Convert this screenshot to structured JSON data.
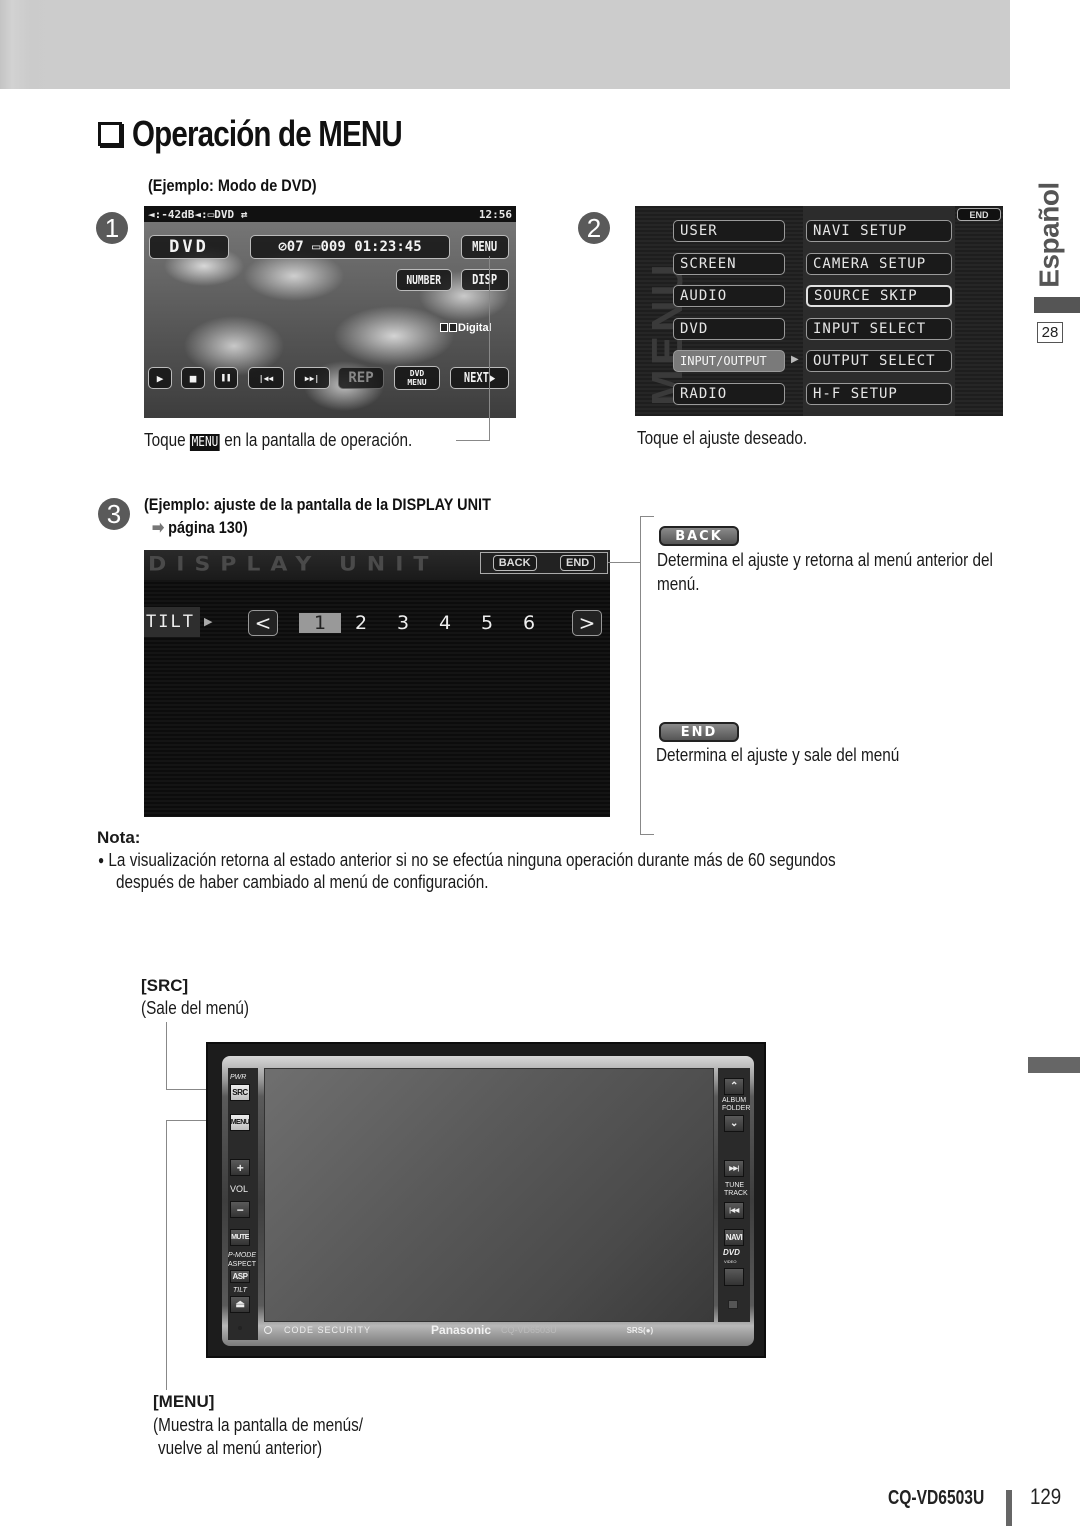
{
  "header": {
    "title": "Operación de MENU",
    "title_icon": "checkbox-square-icon"
  },
  "sidebar": {
    "language": "Español",
    "page_badge": "28"
  },
  "step1": {
    "number": "1",
    "caption": "(Ejemplo: Modo de DVD)",
    "instruction_pre": "Toque",
    "instruction_button": "MENU",
    "instruction_post": "en la pantalla de operación.",
    "screen": {
      "status_left": "◄:-42dB◄:▭DVD ⇄",
      "clock": "12:56",
      "source_label": "DVD",
      "track_info": "⊘07 ▭009 01:23:45",
      "buttons": {
        "menu": "MENU",
        "number": "NUMBER",
        "disp": "DISP",
        "rep": "REP",
        "dvd_menu_line1": "DVD",
        "dvd_menu_line2": "MENU",
        "next": "NEXT▶"
      },
      "transport": {
        "play": "▶",
        "stop": "■",
        "pause": "❚❚",
        "prev": "|◀◀",
        "next": "▶▶|"
      },
      "digital_badge": "Digital"
    }
  },
  "step2": {
    "number": "2",
    "instruction": "Toque el ajuste deseado.",
    "screen": {
      "watermark": "MENU",
      "end_button": "END",
      "left_menu": [
        "USER",
        "SCREEN",
        "AUDIO",
        "DVD",
        "INPUT/OUTPUT",
        "RADIO"
      ],
      "active_left_index": 4,
      "right_menu": [
        "NAVI SETUP",
        "CAMERA SETUP",
        "SOURCE SKIP",
        "INPUT SELECT",
        "OUTPUT SELECT",
        "H-F SETUP"
      ],
      "highlight_right_index": 2,
      "arrow": "▶"
    }
  },
  "step3": {
    "number": "3",
    "caption_line1": "(Ejemplo: ajuste de la pantalla de la DISPLAY UNIT",
    "caption_arrow": "➡",
    "caption_line2": "página 130)",
    "screen": {
      "title": "DISPLAY UNIT",
      "back_button": "BACK",
      "end_button": "END",
      "setting_label": "TILT",
      "setting_arrow": "▶",
      "prev": "<",
      "next": ">",
      "values": [
        "1",
        "2",
        "3",
        "4",
        "5",
        "6"
      ],
      "selected_value": "1"
    }
  },
  "explanations": {
    "back": {
      "button": "BACK",
      "text_line1": "Determina el ajuste y retorna al menú anterior del",
      "text_line2": "menú."
    },
    "end": {
      "button": "END",
      "text": "Determina el ajuste y sale del menú"
    }
  },
  "note": {
    "heading": "Nota:",
    "bullet": "●",
    "line1": "La visualización retorna al estado anterior si no se efectúa ninguna operación durante más de 60 segundos",
    "line2": "después de haber cambiado al menú de configuración."
  },
  "device": {
    "src_callout_title": "[SRC]",
    "src_callout_text": "(Sale del menú)",
    "menu_callout_title": "[MENU]",
    "menu_callout_line1": "(Muestra la pantalla de menús/",
    "menu_callout_line2": "vuelve al menú anterior)",
    "left_labels": {
      "pwr": "PWR",
      "src": "SRC",
      "menu": "MENU",
      "vol_plus": "+",
      "vol": "VOL",
      "vol_minus": "−",
      "mute": "MUTE",
      "pmode": "P-MODE",
      "aspect": "ASPECT",
      "asp": "ASP",
      "tilt": "TILT",
      "eject": "⏏"
    },
    "right_labels": {
      "up": "⌃",
      "album": "ALBUM",
      "folder": "FOLDER",
      "down": "⌄",
      "next": "▶▶|",
      "tune": "TUNE",
      "track": "TRACK",
      "prev": "|◀◀",
      "navi": "NAVI",
      "dvd_logo": "DVD",
      "dvd_video": "VIDEO"
    },
    "code_security": "CODE SECURITY",
    "brand": "Panasonic",
    "model": "CQ-VD6503U",
    "srs": "SRS(●)"
  },
  "footer": {
    "model": "CQ-VD6503U",
    "page_number": "129"
  }
}
